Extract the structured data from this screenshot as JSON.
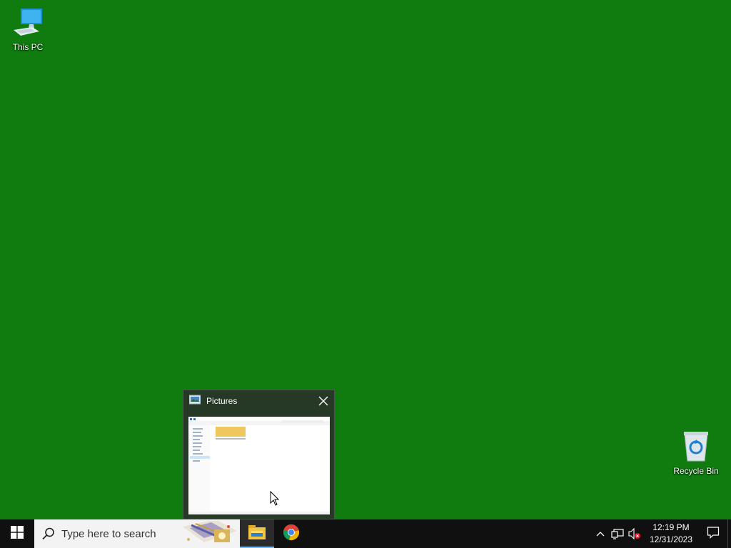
{
  "desktop": {
    "background_color": "#107c10",
    "icons": [
      {
        "label": "This PC",
        "icon": "this-pc-icon"
      },
      {
        "label": "Recycle Bin",
        "icon": "recycle-bin-icon"
      }
    ]
  },
  "thumbnail": {
    "title": "Pictures",
    "icon": "pictures-folder-icon",
    "close_icon": "close-icon"
  },
  "taskbar": {
    "search_placeholder": "Type here to search",
    "apps": [
      {
        "name": "File Explorer",
        "icon": "file-explorer-icon",
        "active": true
      },
      {
        "name": "Google Chrome",
        "icon": "chrome-icon",
        "active": false
      }
    ],
    "clock": {
      "time": "12:19 PM",
      "date": "12/31/2023"
    },
    "tray_icons": [
      "chevron-up-icon",
      "network-icon",
      "volume-muted-icon"
    ],
    "accent_color": "#76b9ed"
  }
}
